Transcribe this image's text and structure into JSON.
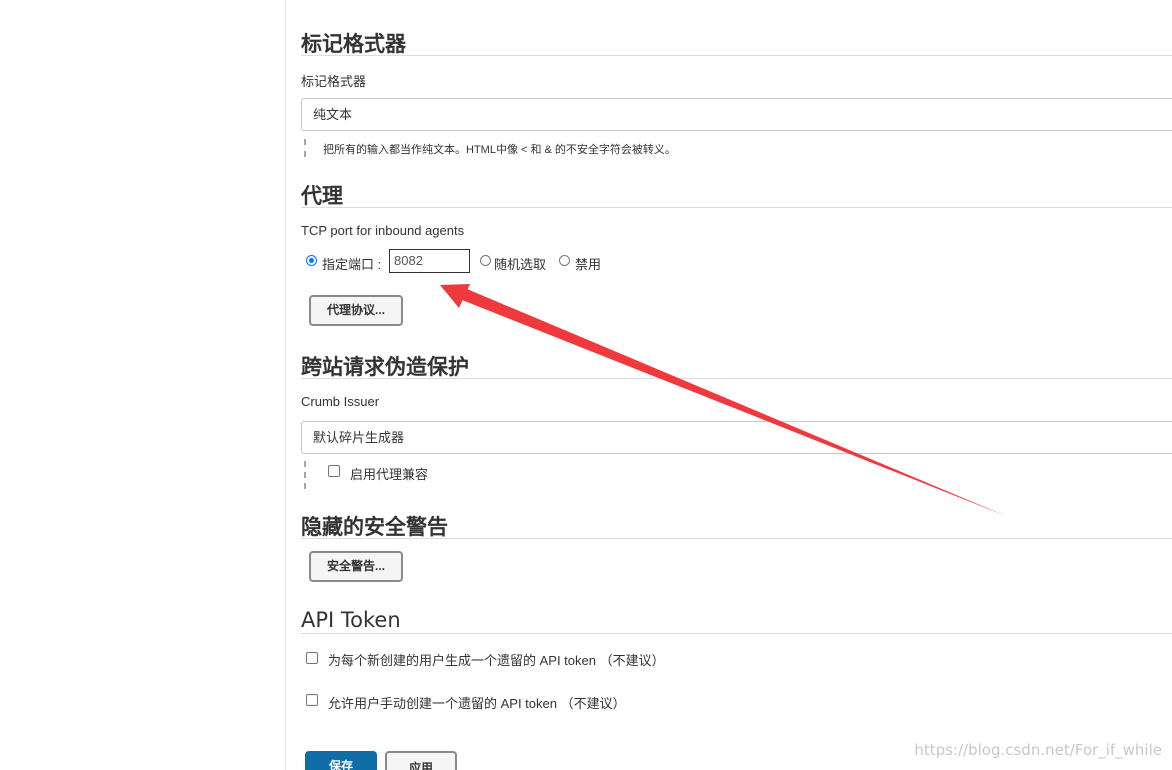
{
  "markup_formatter": {
    "section_title": "标记格式器",
    "field_label": "标记格式器",
    "selected_value": "纯文本",
    "help_text": "把所有的输入都当作纯文本。HTML中像 < 和 & 的不安全字符会被转义。"
  },
  "agents": {
    "section_title": "代理",
    "field_label": "TCP port for inbound agents",
    "options": {
      "fixed_label": "指定端口 :",
      "random_label": "随机选取",
      "disable_label": "禁用"
    },
    "selected_option": "fixed",
    "port_value": "8082",
    "protocols_button": "代理协议..."
  },
  "csrf": {
    "section_title": "跨站请求伪造保护",
    "field_label": "Crumb Issuer",
    "selected_value": "默认碎片生成器",
    "proxy_compat_label": "启用代理兼容",
    "proxy_compat_checked": false
  },
  "hidden_warnings": {
    "section_title": "隐藏的安全警告",
    "button": "安全警告..."
  },
  "api_token": {
    "section_title": "API Token",
    "option1": "为每个新创建的用户生成一个遗留的 API token （不建议）",
    "option2": "允许用户手动创建一个遗留的 API token （不建议）",
    "option1_checked": false,
    "option2_checked": false
  },
  "footer": {
    "save_button": "保存",
    "apply_button": "应用"
  },
  "watermark": "https://blog.csdn.net/For_if_while",
  "annotation": {
    "arrow_color": "#f0393c"
  }
}
